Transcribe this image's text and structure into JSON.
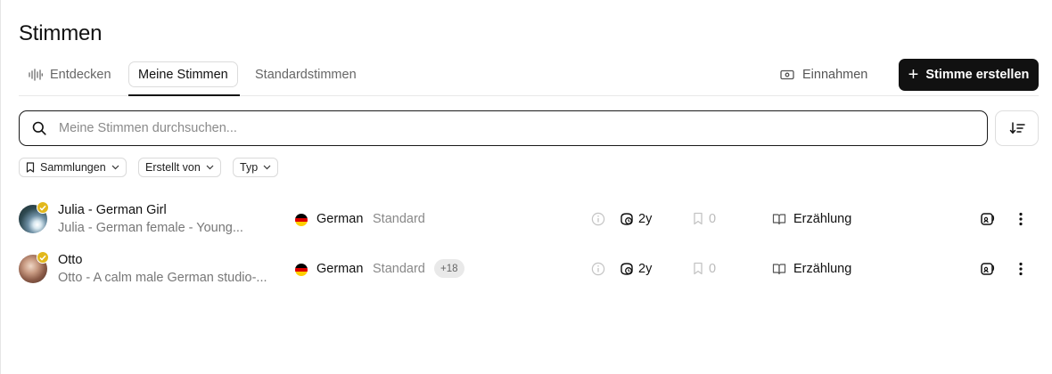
{
  "header": {
    "title": "Stimmen"
  },
  "tabs": {
    "discover": "Entdecken",
    "mine": "Meine Stimmen",
    "default": "Standardstimmen"
  },
  "actions": {
    "earnings": "Einnahmen",
    "create": "Stimme erstellen"
  },
  "search": {
    "placeholder": "Meine Stimmen durchsuchen...",
    "value": ""
  },
  "filters": {
    "collections": "Sammlungen",
    "created_by": "Erstellt von",
    "type": "Typ"
  },
  "voices": [
    {
      "name": "Julia - German Girl",
      "description": "Julia - German female - Young...",
      "language": "German",
      "variant": "Standard",
      "extra_languages": "",
      "age": "2y",
      "saves": "0",
      "category": "Erzählung",
      "verified": true
    },
    {
      "name": "Otto",
      "description": "Otto - A calm male German studio-...",
      "language": "German",
      "variant": "Standard",
      "extra_languages": "+18",
      "age": "2y",
      "saves": "0",
      "category": "Erzählung",
      "verified": true
    }
  ],
  "colors": {
    "primary_button": "#111111",
    "verified_badge": "#e2b81c",
    "flag_black": "#000000",
    "flag_red": "#dd0000",
    "flag_gold": "#ffce00"
  }
}
